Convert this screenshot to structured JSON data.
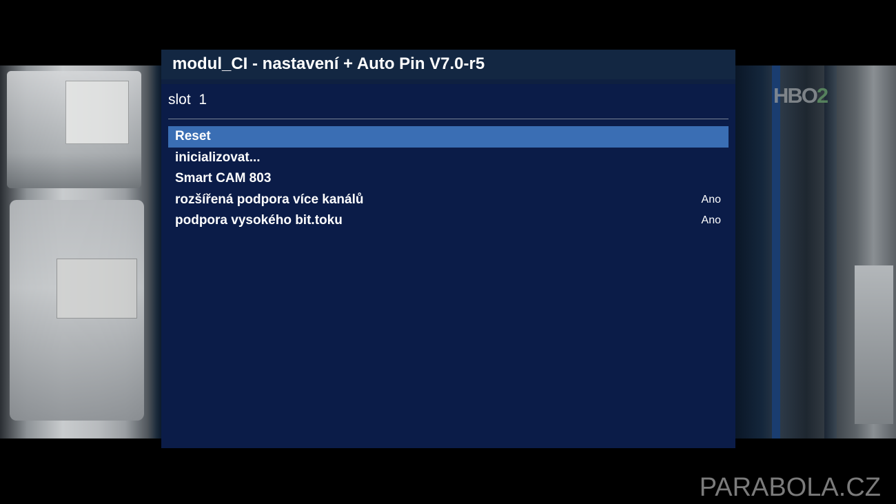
{
  "channel_logo": {
    "text_main": "HBO",
    "text_num": "2"
  },
  "dialog": {
    "title": "modul_CI - nastavení + Auto Pin V7.0-r5",
    "slot_label": "slot  1",
    "menu_items": [
      {
        "label": "Reset",
        "value": "",
        "selected": true
      },
      {
        "label": "inicializovat...",
        "value": "",
        "selected": false
      },
      {
        "label": "Smart CAM 803",
        "value": "",
        "selected": false
      },
      {
        "label": "rozšířená podpora více kanálů",
        "value": "Ano",
        "selected": false
      },
      {
        "label": "podpora vysokého bit.toku",
        "value": "Ano",
        "selected": false
      }
    ]
  },
  "watermark": "PARABOLA.CZ",
  "colors": {
    "dialog_bg": "#0b1c48",
    "titlebar_bg": "#132742",
    "selection": "#3a6eb4",
    "text": "#ffffff"
  }
}
